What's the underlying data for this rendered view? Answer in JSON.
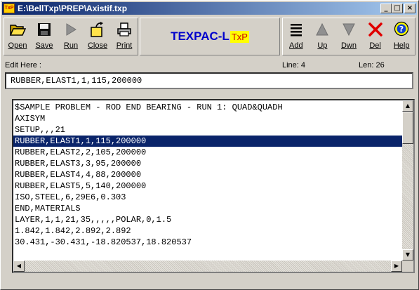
{
  "window": {
    "title": "E:\\BellTxp\\PREP\\Axistif.txp",
    "icon_text": "TxP",
    "minimize_glyph": "_",
    "maximize_glyph": "□",
    "close_glyph": "×"
  },
  "toolbar": {
    "open_label": "Open",
    "save_label": "Save",
    "run_label": "Run",
    "close_label": "Close",
    "print_label": "Print",
    "add_label": "Add",
    "up_label": "Up",
    "down_label": "Dwn",
    "del_label": "Del",
    "help_label": "Help"
  },
  "brand": {
    "name": "TEXPAC-L",
    "badge": "TxP"
  },
  "editor": {
    "label": "Edit Here :",
    "line_info": "Line: 4",
    "len_info": "Len: 26",
    "value": "RUBBER,ELAST1,1,115,200000"
  },
  "listing": {
    "selected_index": 3,
    "lines": [
      "$SAMPLE PROBLEM - ROD END BEARING - RUN 1: QUAD&QUADH",
      "AXISYM",
      "SETUP,,,21",
      "RUBBER,ELAST1,1,115,200000",
      "RUBBER,ELAST2,2,105,200000",
      "RUBBER,ELAST3,3,95,200000",
      "RUBBER,ELAST4,4,88,200000",
      "RUBBER,ELAST5,5,140,200000",
      "ISO,STEEL,6,29E6,0.303",
      "END,MATERIALS",
      "LAYER,1,1,21,35,,,,,POLAR,0,1.5",
      "1.842,1.842,2.892,2.892",
      "30.431,-30.431,-18.820537,18.820537"
    ]
  },
  "colors": {
    "face": "#d4d0c8",
    "title_start": "#0a246a",
    "title_end": "#a6caf0",
    "brand_text": "#0000cc",
    "badge_bg": "#ffff00",
    "badge_text": "#cc0000",
    "selection": "#0a246a"
  }
}
